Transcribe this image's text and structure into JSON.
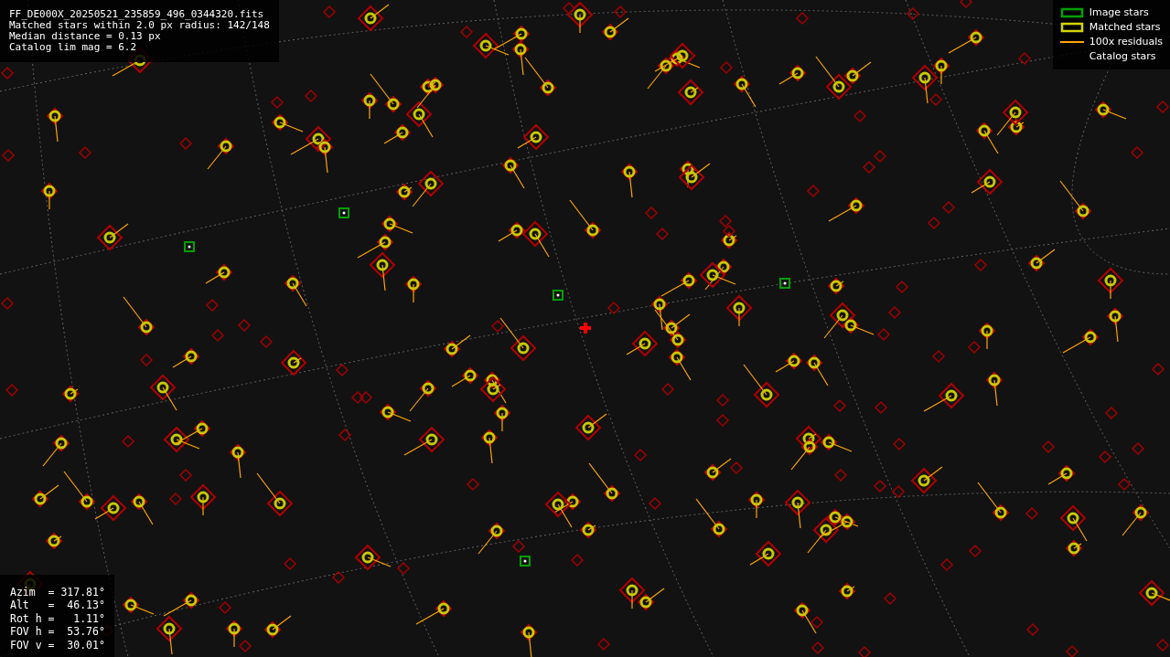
{
  "info_box": {
    "lines": [
      "FF_DE000X_20250521_235859_496_0344320.fits",
      "Matched stars within 2.0 px radius: 142/148",
      "Median distance = 0.13 px",
      "Catalog lim mag = 6.2"
    ]
  },
  "legend": {
    "items": [
      {
        "kind": "box",
        "color": "#00a000",
        "label": "Image stars"
      },
      {
        "kind": "box",
        "color": "#d4d400",
        "label": "Matched stars"
      },
      {
        "kind": "line",
        "color": "#ffa500",
        "label": "100x residuals"
      },
      {
        "kind": "plain",
        "label": "Catalog stars"
      }
    ]
  },
  "pointing_box": {
    "lines": [
      "Azim  = 317.81°",
      "Alt   =  46.13°",
      "Rot h =   1.11°",
      "FOV h =  53.76°",
      "FOV v =  30.01°"
    ]
  }
}
